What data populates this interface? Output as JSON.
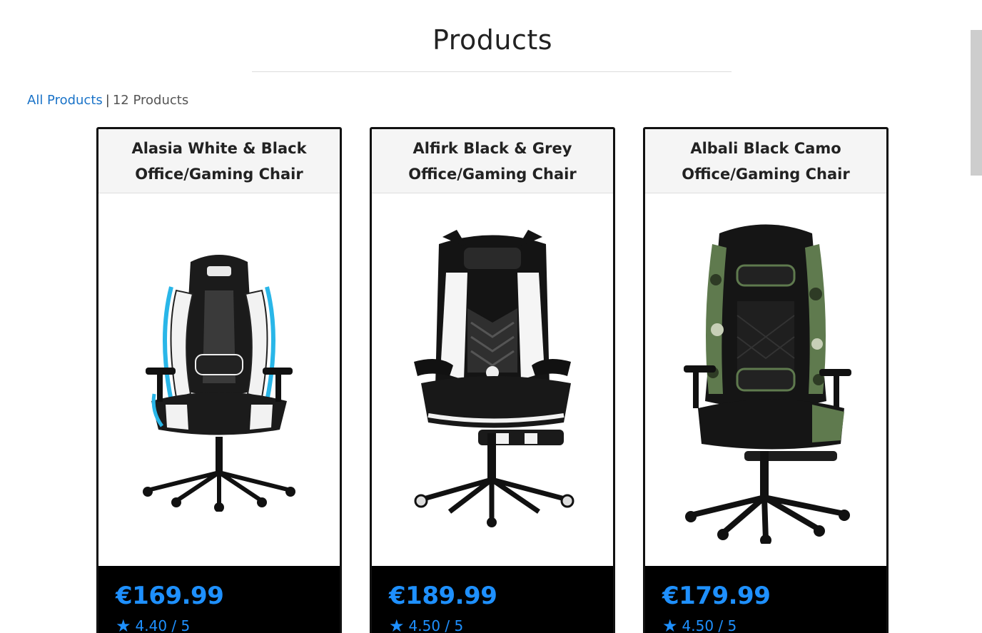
{
  "header": {
    "title": "Products"
  },
  "breadcrumb": {
    "link": "All Products",
    "separator": "|",
    "count": "12 Products"
  },
  "products": [
    {
      "name": "Alasia White & Black Office/Gaming Chair",
      "price": "€169.99",
      "rating": "4.40 / 5",
      "accent": "#29b6e8",
      "image_icon": "gaming-chair-white-black"
    },
    {
      "name": "Alfirk Black & Grey Office/Gaming Chair",
      "price": "€189.99",
      "rating": "4.50 / 5",
      "accent": "#ffffff",
      "image_icon": "gaming-chair-black-grey"
    },
    {
      "name": "Albali Black Camo Office/Gaming Chair",
      "price": "€179.99",
      "rating": "4.50 / 5",
      "accent": "#5f7a4e",
      "image_icon": "gaming-chair-black-camo"
    }
  ],
  "colors": {
    "price": "#1e90ff",
    "link": "#1a73c8",
    "card_border": "#111111",
    "footer_bg": "#000000"
  }
}
